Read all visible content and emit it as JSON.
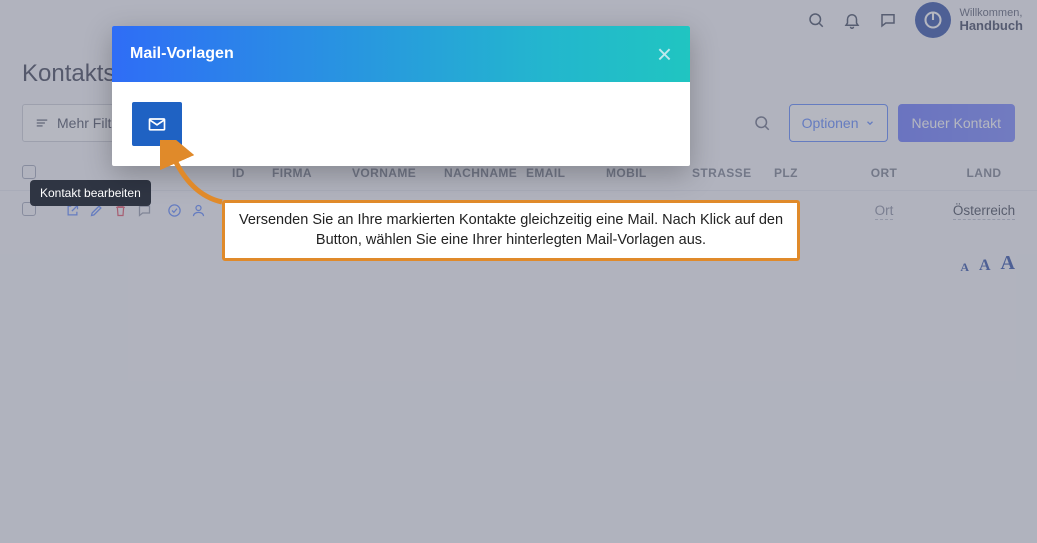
{
  "header": {
    "welcome_label": "Willkommen,",
    "welcome_name": "Handbuch"
  },
  "page_title": "Kontakts",
  "toolbar": {
    "more_filters_label": "Mehr Filt",
    "options_label": "Optionen",
    "new_contact_label": "Neuer Kontakt"
  },
  "tooltip": {
    "edit_contact": "Kontakt bearbeiten"
  },
  "table": {
    "headers": {
      "id": "ID",
      "firma": "FIRMA",
      "vorname": "VORNAME",
      "nachname": "NACHNAME",
      "email": "EMAIL",
      "mobil": "MOBIL",
      "strasse": "STRASSE",
      "plz": "PLZ",
      "ort": "ORT",
      "land": "LAND"
    },
    "rows": [
      {
        "ort": "Ort",
        "land": "Österreich"
      }
    ]
  },
  "modal": {
    "title": "Mail-Vorlagen"
  },
  "callout": {
    "text": "Versenden Sie an Ihre markierten Kontakte gleichzeitig eine Mail. Nach Klick auf den Button, wählen Sie eine Ihrer hinterlegten Mail-Vorlagen aus."
  },
  "fontsize": {
    "s": "A",
    "m": "A",
    "l": "A"
  }
}
